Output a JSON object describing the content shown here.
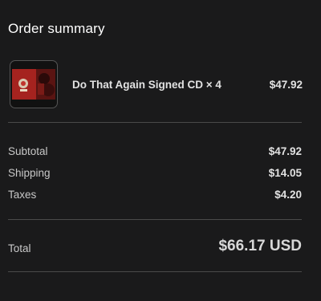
{
  "header": {
    "title": "Order summary"
  },
  "line_items": [
    {
      "name": "Do That Again Signed CD × 4",
      "price": "$47.92"
    }
  ],
  "totals": {
    "subtotal_label": "Subtotal",
    "subtotal_value": "$47.92",
    "shipping_label": "Shipping",
    "shipping_value": "$14.05",
    "taxes_label": "Taxes",
    "taxes_value": "$4.20",
    "total_label": "Total",
    "total_value": "$66.17 USD"
  },
  "colors": {
    "background": "#1a1a1b",
    "divider": "#4a4a4a",
    "album_red": "#b32622"
  }
}
